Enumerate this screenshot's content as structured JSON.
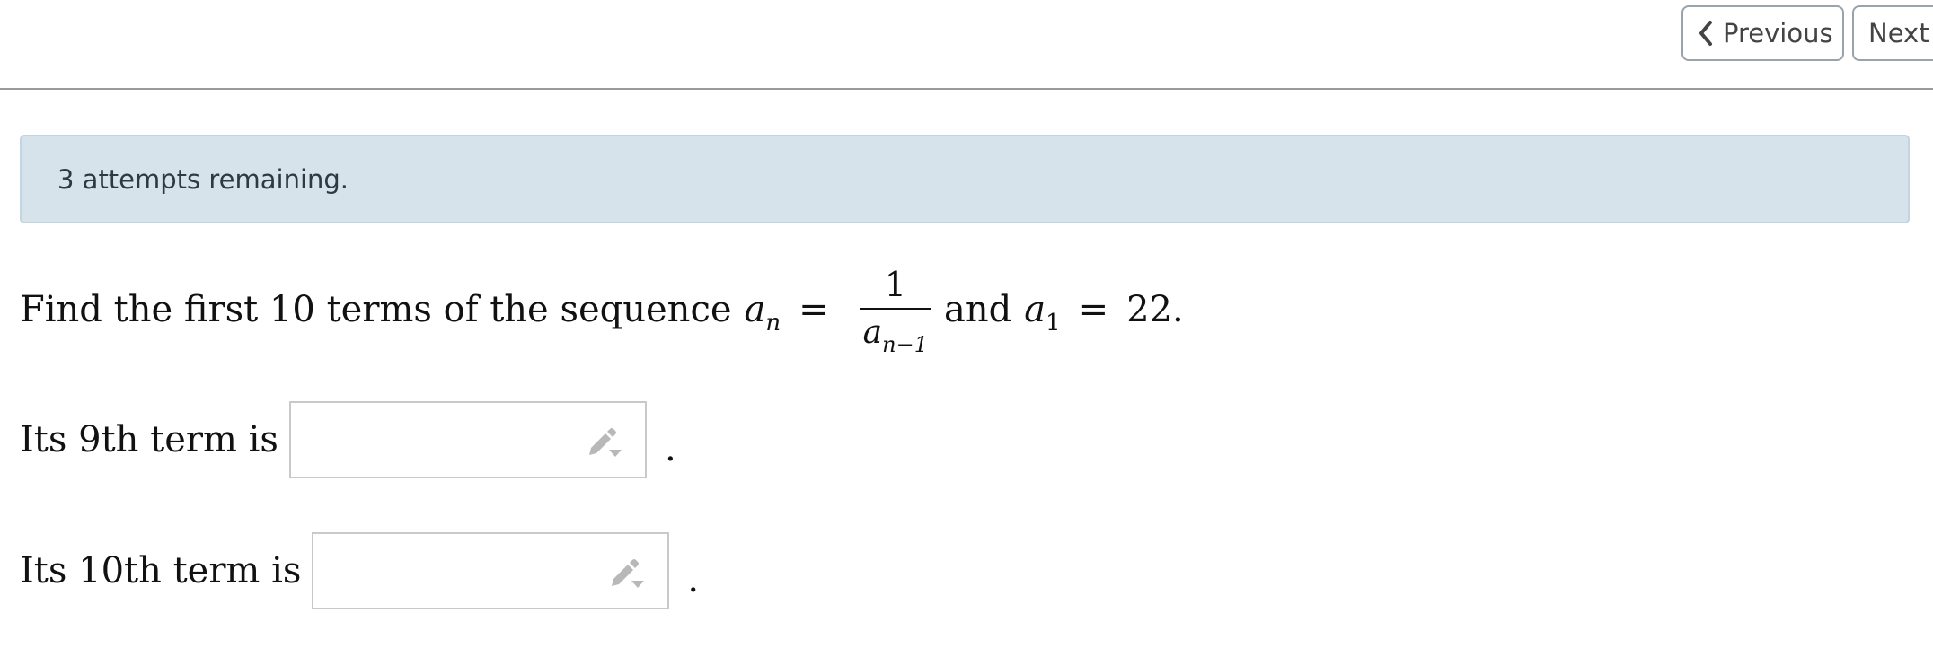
{
  "nav": {
    "previous_label": "Previous",
    "next_label": "Next"
  },
  "banner": {
    "text": "3 attempts remaining."
  },
  "question": {
    "prefix": "Find the first 10 terms of the sequence",
    "var_a": "a",
    "sub_n": "n",
    "equals": "=",
    "numerator": "1",
    "den_sub": "n−1",
    "connector": "and",
    "sub_1": "1",
    "initial_value": "22."
  },
  "answers": {
    "ninth_label": "Its 9th term is",
    "ninth_value": "",
    "tenth_label": "Its 10th term is",
    "tenth_value": "",
    "period": "."
  },
  "colors": {
    "banner_bg": "#d6e3ea",
    "banner_border": "#c2d5e0",
    "icon_gray": "#b5b5b5"
  },
  "icons": {
    "previous": "chevron-left-icon",
    "answer_tool": "pencil-dropdown-icon"
  }
}
